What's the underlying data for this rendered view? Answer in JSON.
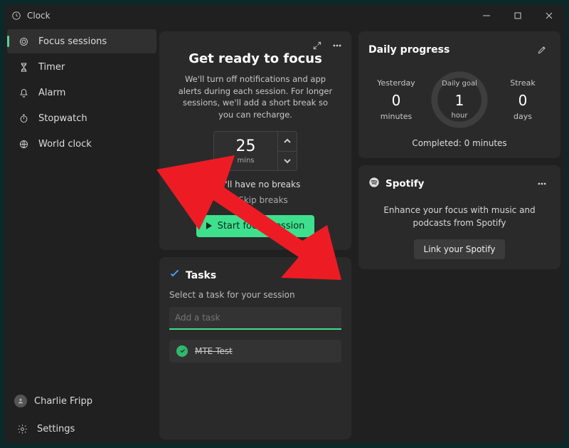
{
  "app": {
    "title": "Clock"
  },
  "sidebar": {
    "items": [
      {
        "id": "focus-sessions",
        "label": "Focus sessions",
        "selected": true
      },
      {
        "id": "timer",
        "label": "Timer"
      },
      {
        "id": "alarm",
        "label": "Alarm"
      },
      {
        "id": "stopwatch",
        "label": "Stopwatch"
      },
      {
        "id": "world-clock",
        "label": "World clock"
      }
    ],
    "user": {
      "name": "Charlie Fripp"
    },
    "settings_label": "Settings"
  },
  "focus": {
    "title": "Get ready to focus",
    "description": "We'll turn off notifications and app alerts during each session. For longer sessions, we'll add a short break so you can recharge.",
    "duration_value": "25",
    "duration_unit": "mins",
    "breaks_note": "You'll have no breaks",
    "skip_label": "Skip breaks",
    "start_label": "Start focus session"
  },
  "tasks": {
    "title": "Tasks",
    "subtitle": "Select a task for your session",
    "input_placeholder": "Add a task",
    "items": [
      {
        "label": "MTE Test",
        "completed": true
      }
    ]
  },
  "progress": {
    "title": "Daily progress",
    "yesterday": {
      "label": "Yesterday",
      "value": "0",
      "unit": "minutes"
    },
    "goal": {
      "label": "Daily goal",
      "value": "1",
      "unit": "hour"
    },
    "streak": {
      "label": "Streak",
      "value": "0",
      "unit": "days"
    },
    "completed_text": "Completed: 0 minutes"
  },
  "spotify": {
    "title": "Spotify",
    "blurb": "Enhance your focus with music and podcasts from Spotify",
    "link_label": "Link your Spotify"
  },
  "colors": {
    "accent": "#3ee08d",
    "accent_dark": "#2fb96b",
    "arrow": "#ed1c24"
  }
}
